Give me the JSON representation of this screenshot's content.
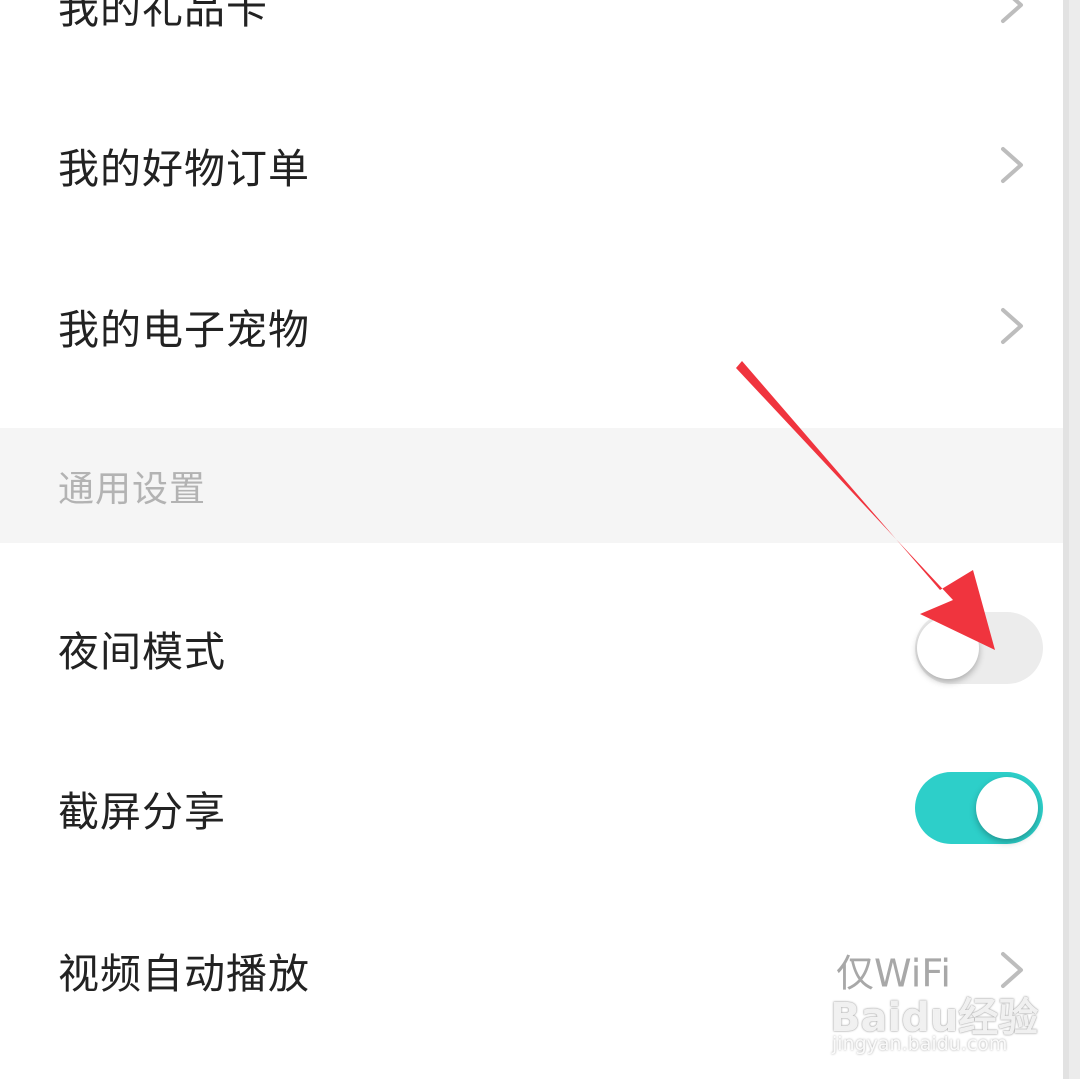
{
  "menu": {
    "items": [
      {
        "label": "我的礼品卡"
      },
      {
        "label": "我的好物订单"
      },
      {
        "label": "我的电子宠物"
      }
    ]
  },
  "section": {
    "title": "通用设置"
  },
  "settings": {
    "night_mode": {
      "label": "夜间模式",
      "enabled": false
    },
    "screenshot_share": {
      "label": "截屏分享",
      "enabled": true
    },
    "video_autoplay": {
      "label": "视频自动播放",
      "value": "仅WiFi"
    }
  },
  "watermark": {
    "brand": "Baidu经验",
    "url": "jingyan.baidu.com"
  },
  "colors": {
    "toggle_on": "#2dcfc9",
    "toggle_off": "#ececec",
    "arrow": "#f0343e",
    "section_bg": "#f5f5f5"
  },
  "icons": {
    "chevron": "chevron-right-icon",
    "annotation": "red-arrow-icon"
  }
}
